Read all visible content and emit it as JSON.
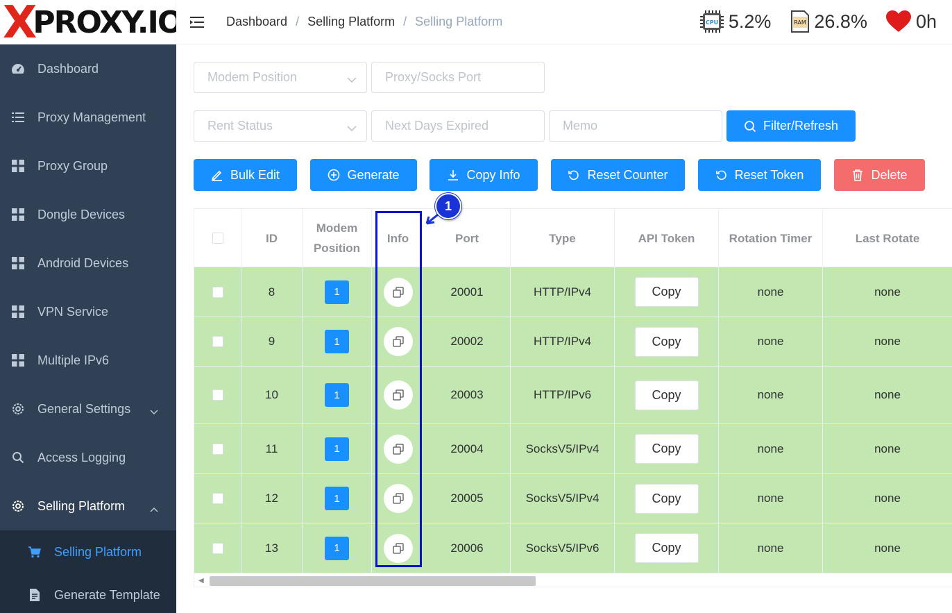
{
  "logo": {
    "x_letter": "X",
    "text": "PROXY.IO"
  },
  "sidebar": {
    "items": [
      {
        "label": "Dashboard",
        "icon": "dashboard-icon"
      },
      {
        "label": "Proxy Management",
        "icon": "list-icon"
      },
      {
        "label": "Proxy Group",
        "icon": "grid-icon"
      },
      {
        "label": "Dongle Devices",
        "icon": "grid-icon"
      },
      {
        "label": "Android Devices",
        "icon": "grid-icon"
      },
      {
        "label": "VPN Service",
        "icon": "grid-icon"
      },
      {
        "label": "Multiple IPv6",
        "icon": "grid-icon"
      },
      {
        "label": "General Settings",
        "icon": "gear-icon"
      },
      {
        "label": "Access Logging",
        "icon": "search-icon"
      },
      {
        "label": "Selling Platform",
        "icon": "gear-icon"
      }
    ],
    "sub_items": [
      {
        "label": "Selling Platform",
        "icon": "cart-icon"
      },
      {
        "label": "Generate Template",
        "icon": "document-icon"
      }
    ]
  },
  "header": {
    "breadcrumb": [
      "Dashboard",
      "Selling Platform",
      "Selling Platform"
    ],
    "cpu": "5.2%",
    "ram": "26.8%",
    "uptime": "0h",
    "cpu_icon_label": "CPU",
    "ram_icon_label": "RAM"
  },
  "filters": {
    "modem_position": "Modem Position",
    "proxy_port": "Proxy/Socks Port",
    "rent_status": "Rent Status",
    "next_days": "Next Days Expired",
    "memo": "Memo",
    "filter_button": "Filter/Refresh"
  },
  "actions": {
    "bulk_edit": "Bulk Edit",
    "generate": "Generate",
    "copy_info": "Copy Info",
    "reset_counter": "Reset Counter",
    "reset_token": "Reset Token",
    "delete": "Delete"
  },
  "table": {
    "headers": {
      "id": "ID",
      "modem_position_1": "Modem",
      "modem_position_2": "Position",
      "info": "Info",
      "port": "Port",
      "type": "Type",
      "api_token": "API Token",
      "rotation_timer": "Rotation Timer",
      "last_rotate": "Last Rotate"
    },
    "rows": [
      {
        "id": "8",
        "position": "1",
        "port": "20001",
        "type": "HTTP/IPv4",
        "api_token": "Copy",
        "rotation_timer": "none",
        "last_rotate": "none"
      },
      {
        "id": "9",
        "position": "1",
        "port": "20002",
        "type": "HTTP/IPv4",
        "api_token": "Copy",
        "rotation_timer": "none",
        "last_rotate": "none"
      },
      {
        "id": "10",
        "position": "1",
        "port": "20003",
        "type": "HTTP/IPv6",
        "api_token": "Copy",
        "rotation_timer": "none",
        "last_rotate": "none"
      },
      {
        "id": "11",
        "position": "1",
        "port": "20004",
        "type": "SocksV5/IPv4",
        "api_token": "Copy",
        "rotation_timer": "none",
        "last_rotate": "none"
      },
      {
        "id": "12",
        "position": "1",
        "port": "20005",
        "type": "SocksV5/IPv4",
        "api_token": "Copy",
        "rotation_timer": "none",
        "last_rotate": "none"
      },
      {
        "id": "13",
        "position": "1",
        "port": "20006",
        "type": "SocksV5/IPv6",
        "api_token": "Copy",
        "rotation_timer": "none",
        "last_rotate": "none"
      }
    ]
  },
  "annotation": {
    "badge": "1"
  },
  "colors": {
    "primary": "#1890ff",
    "danger": "#f56c6c",
    "row_success": "#c2e7b0",
    "sidebar": "#304156",
    "annotation": "#0a14c8"
  }
}
